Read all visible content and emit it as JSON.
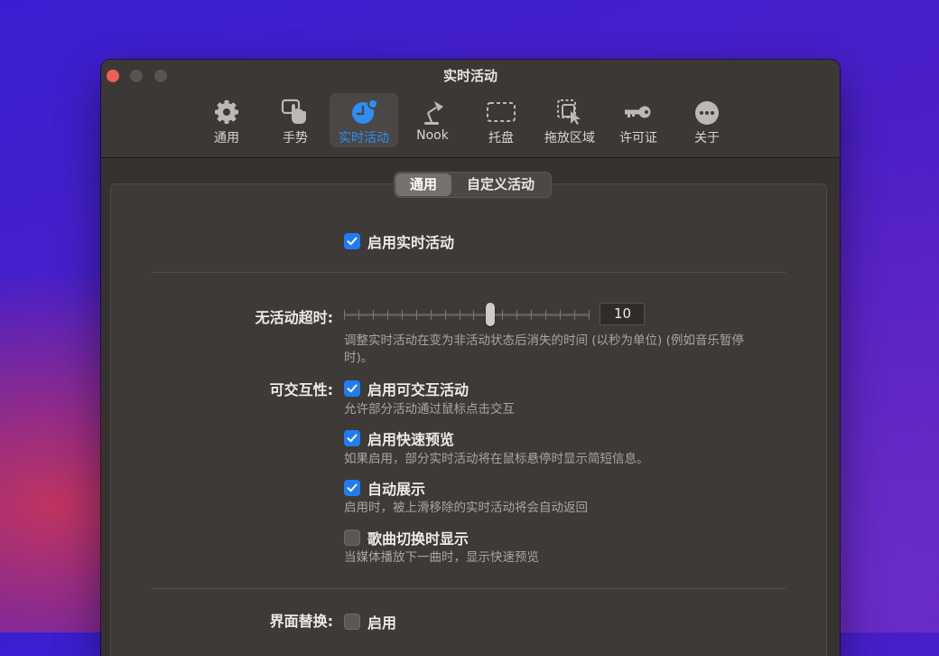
{
  "window": {
    "title": "实时活动"
  },
  "toolbar": {
    "tabs": [
      {
        "label": "通用",
        "icon": "gear-icon",
        "active": false
      },
      {
        "label": "手势",
        "icon": "hand-pointer-icon",
        "active": false
      },
      {
        "label": "实时活动",
        "icon": "live-activity-icon",
        "active": true
      },
      {
        "label": "Nook",
        "icon": "lamp-icon",
        "active": false
      },
      {
        "label": "托盘",
        "icon": "tray-icon",
        "active": false
      },
      {
        "label": "拖放区域",
        "icon": "drop-zone-icon",
        "active": false
      },
      {
        "label": "许可证",
        "icon": "key-icon",
        "active": false
      },
      {
        "label": "关于",
        "icon": "ellipsis-icon",
        "active": false
      }
    ]
  },
  "segments": {
    "items": [
      "通用",
      "自定义活动"
    ],
    "selected": "通用"
  },
  "settings": {
    "enable_live": {
      "label": "启用实时活动",
      "checked": true
    },
    "timeout": {
      "label": "无活动超时:",
      "value": "10",
      "slider_fraction": 0.6,
      "description": "调整实时活动在变为非活动状态后消失的时间 (以秒为单位) (例如音乐暂停时)。"
    },
    "interactivity": {
      "label": "可交互性:",
      "options": [
        {
          "label": "启用可交互活动",
          "checked": true,
          "description": "允许部分活动通过鼠标点击交互"
        },
        {
          "label": "启用快速预览",
          "checked": true,
          "description": "如果启用，部分实时活动将在鼠标悬停时显示简短信息。"
        },
        {
          "label": "自动展示",
          "checked": true,
          "description": "启用时，被上滑移除的实时活动将会自动返回"
        },
        {
          "label": "歌曲切换时显示",
          "checked": false,
          "description": "当媒体播放下一曲时，显示快速预览"
        }
      ]
    },
    "ui_replace": {
      "label": "界面替换:",
      "option": {
        "label": "启用",
        "checked": false
      }
    }
  },
  "colors": {
    "accent": "#1f7cf3",
    "window_bg": "#353230",
    "close_button": "#ed5f57"
  }
}
